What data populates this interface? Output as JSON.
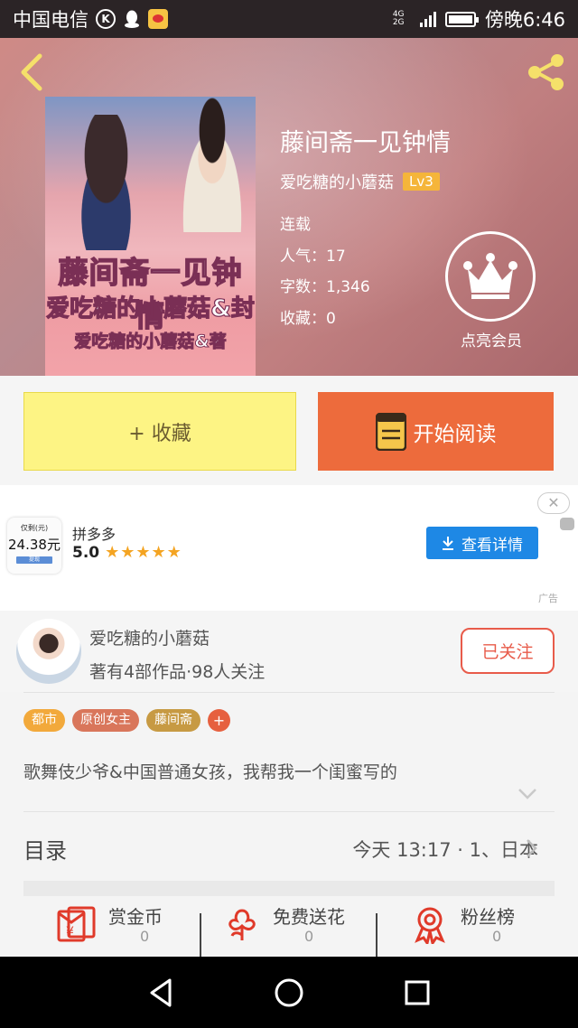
{
  "status_bar": {
    "carrier": "中国电信",
    "k_icon": "K",
    "network": "4G 2G",
    "time": "傍晚6:46"
  },
  "book": {
    "title": "藤间斋一见钟情",
    "author": "爱吃糖的小蘑菇",
    "level": "Lv3",
    "status": "连载",
    "popularity": "人气：17",
    "word_count": "字数：1,346",
    "favorites": "收藏：0",
    "vip_label": "点亮会员",
    "cover_title": "藤间斋一见钟情",
    "cover_line2": "爱吃糖的小蘑菇&封",
    "cover_line3": "爱吃糖的小蘑菇&著"
  },
  "actions": {
    "collect_label": "+ 收藏",
    "read_label": "开始阅读"
  },
  "ad": {
    "close": "✕",
    "app_name": "拼多多",
    "rating": "5.0",
    "stars": "★★★★★",
    "button_label": "查看详情",
    "icon_top": "仅剩(元)",
    "icon_amount": "24.38元",
    "icon_sub": "提现",
    "ad_tag": "广告"
  },
  "author_card": {
    "name": "爱吃糖的小蘑菇",
    "info": "著有4部作品·98人关注",
    "follow_label": "已关注"
  },
  "tags": [
    {
      "label": "都市",
      "color": "#f2a93b"
    },
    {
      "label": "原创女主",
      "color": "#d9765b"
    },
    {
      "label": "藤间斋",
      "color": "#c79a43"
    }
  ],
  "tag_add": "+",
  "intro": "歌舞伎少爷&中国普通女孩，我帮我一个闺蜜写的",
  "toc": {
    "label": "目录",
    "latest": "今天 13:17 · 1、日本"
  },
  "rewards": [
    {
      "label": "赏金币",
      "count": "0",
      "icon": "red-envelope-icon"
    },
    {
      "label": "免费送花",
      "count": "0",
      "icon": "flower-icon"
    },
    {
      "label": "粉丝榜",
      "count": "0",
      "icon": "medal-icon"
    }
  ],
  "colors": {
    "accent_orange": "#ed6b3c",
    "collect_yellow": "#fdf484",
    "follow_red": "#e85b4a",
    "ad_blue": "#1e88e5"
  }
}
